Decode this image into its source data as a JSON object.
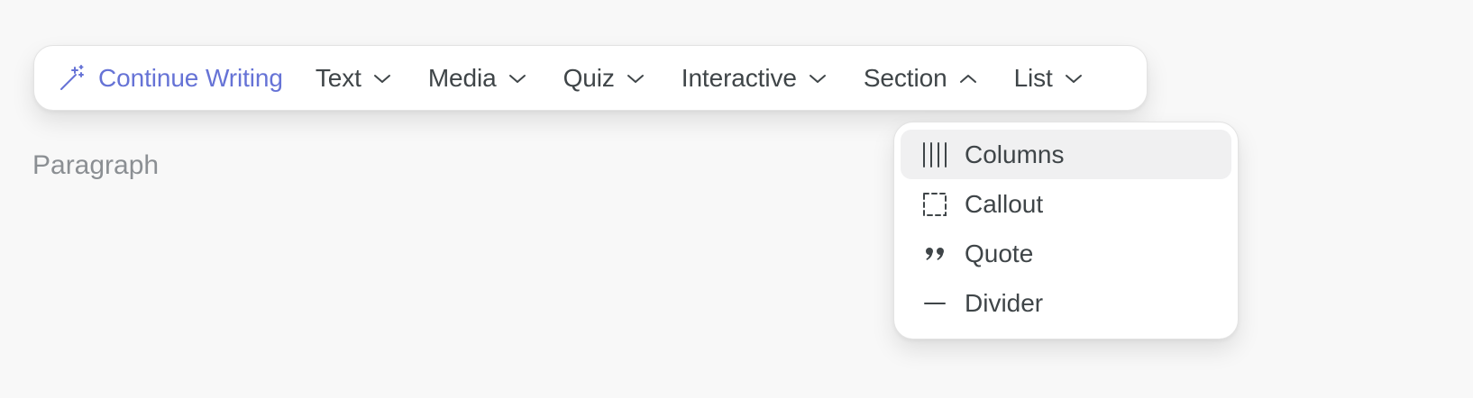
{
  "toolbar": {
    "continue_writing": {
      "label": "Continue Writing",
      "icon": "magic-wand-icon",
      "color": "#6673d6"
    },
    "menus": [
      {
        "label": "Text",
        "icon": "chevron-down-icon"
      },
      {
        "label": "Media",
        "icon": "chevron-down-icon"
      },
      {
        "label": "Quiz",
        "icon": "chevron-down-icon"
      },
      {
        "label": "Interactive",
        "icon": "chevron-down-icon"
      },
      {
        "label": "Section",
        "icon": "chevron-up-icon",
        "open": true
      },
      {
        "label": "List",
        "icon": "chevron-down-icon"
      }
    ]
  },
  "editor": {
    "placeholder": "Paragraph"
  },
  "section_dropdown": {
    "items": [
      {
        "label": "Columns",
        "icon": "columns-icon",
        "highlighted": true
      },
      {
        "label": "Callout",
        "icon": "dashed-square-icon"
      },
      {
        "label": "Quote",
        "icon": "quote-icon"
      },
      {
        "label": "Divider",
        "icon": "divider-line-icon"
      }
    ]
  },
  "colors": {
    "accent": "#6673d6",
    "text": "#3f4548",
    "muted": "#8b8f93",
    "background": "#f8f8f8",
    "highlight": "#f0f0f1"
  }
}
